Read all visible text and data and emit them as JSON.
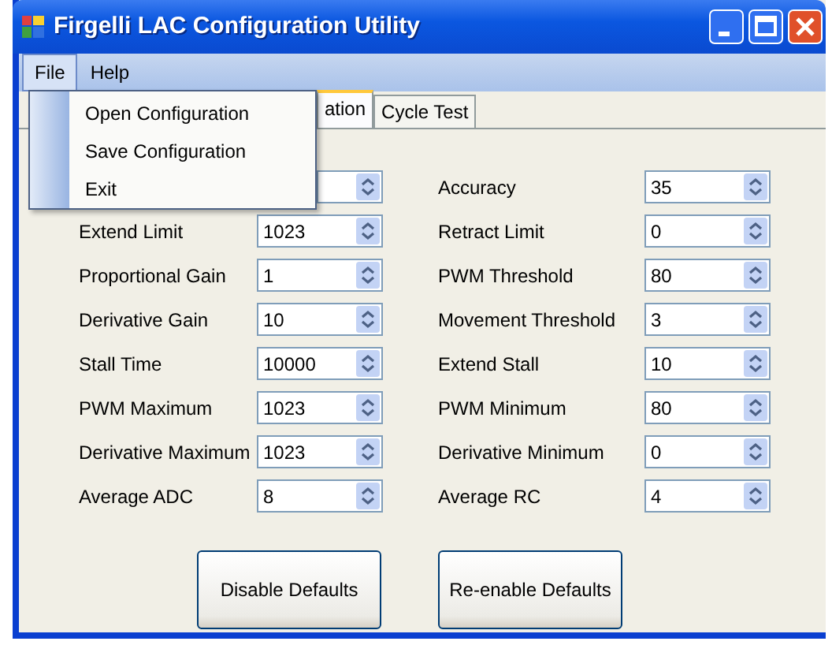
{
  "window": {
    "title": "Firgelli LAC Configuration Utility"
  },
  "menu_bar": [
    {
      "label": "File",
      "selected": true
    },
    {
      "label": "Help",
      "selected": false
    }
  ],
  "open_menu": {
    "items": [
      {
        "label": "Open Configuration"
      },
      {
        "label": "Save Configuration"
      },
      {
        "label": "Exit"
      }
    ]
  },
  "tabs": [
    {
      "label": "ation",
      "selected": true
    },
    {
      "label": "Cycle Test",
      "selected": false
    }
  ],
  "rows": [
    {
      "left": {},
      "right": {
        "label": "Accuracy",
        "value": "35"
      }
    },
    {
      "left": {
        "label": "Extend Limit",
        "value": "1023"
      },
      "right": {
        "label": "Retract Limit",
        "value": "0"
      }
    },
    {
      "left": {
        "label": "Proportional Gain",
        "value": "1"
      },
      "right": {
        "label": "PWM Threshold",
        "value": "80"
      }
    },
    {
      "left": {
        "label": "Derivative Gain",
        "value": "10"
      },
      "right": {
        "label": "Movement Threshold",
        "value": "3"
      }
    },
    {
      "left": {
        "label": "Stall Time",
        "value": "10000"
      },
      "right": {
        "label": "Extend Stall",
        "value": "10"
      }
    },
    {
      "left": {
        "label": "PWM Maximum",
        "value": "1023"
      },
      "right": {
        "label": "PWM Minimum",
        "value": "80"
      }
    },
    {
      "left": {
        "label": "Derivative Maximum",
        "value": "1023"
      },
      "right": {
        "label": "Derivative Minimum",
        "value": "0"
      }
    },
    {
      "left": {
        "label": "Average ADC",
        "value": "8"
      },
      "right": {
        "label": "Average RC",
        "value": "4"
      }
    }
  ],
  "buttons": [
    {
      "label": "Disable Defaults"
    },
    {
      "label": "Re-enable Defaults"
    }
  ]
}
